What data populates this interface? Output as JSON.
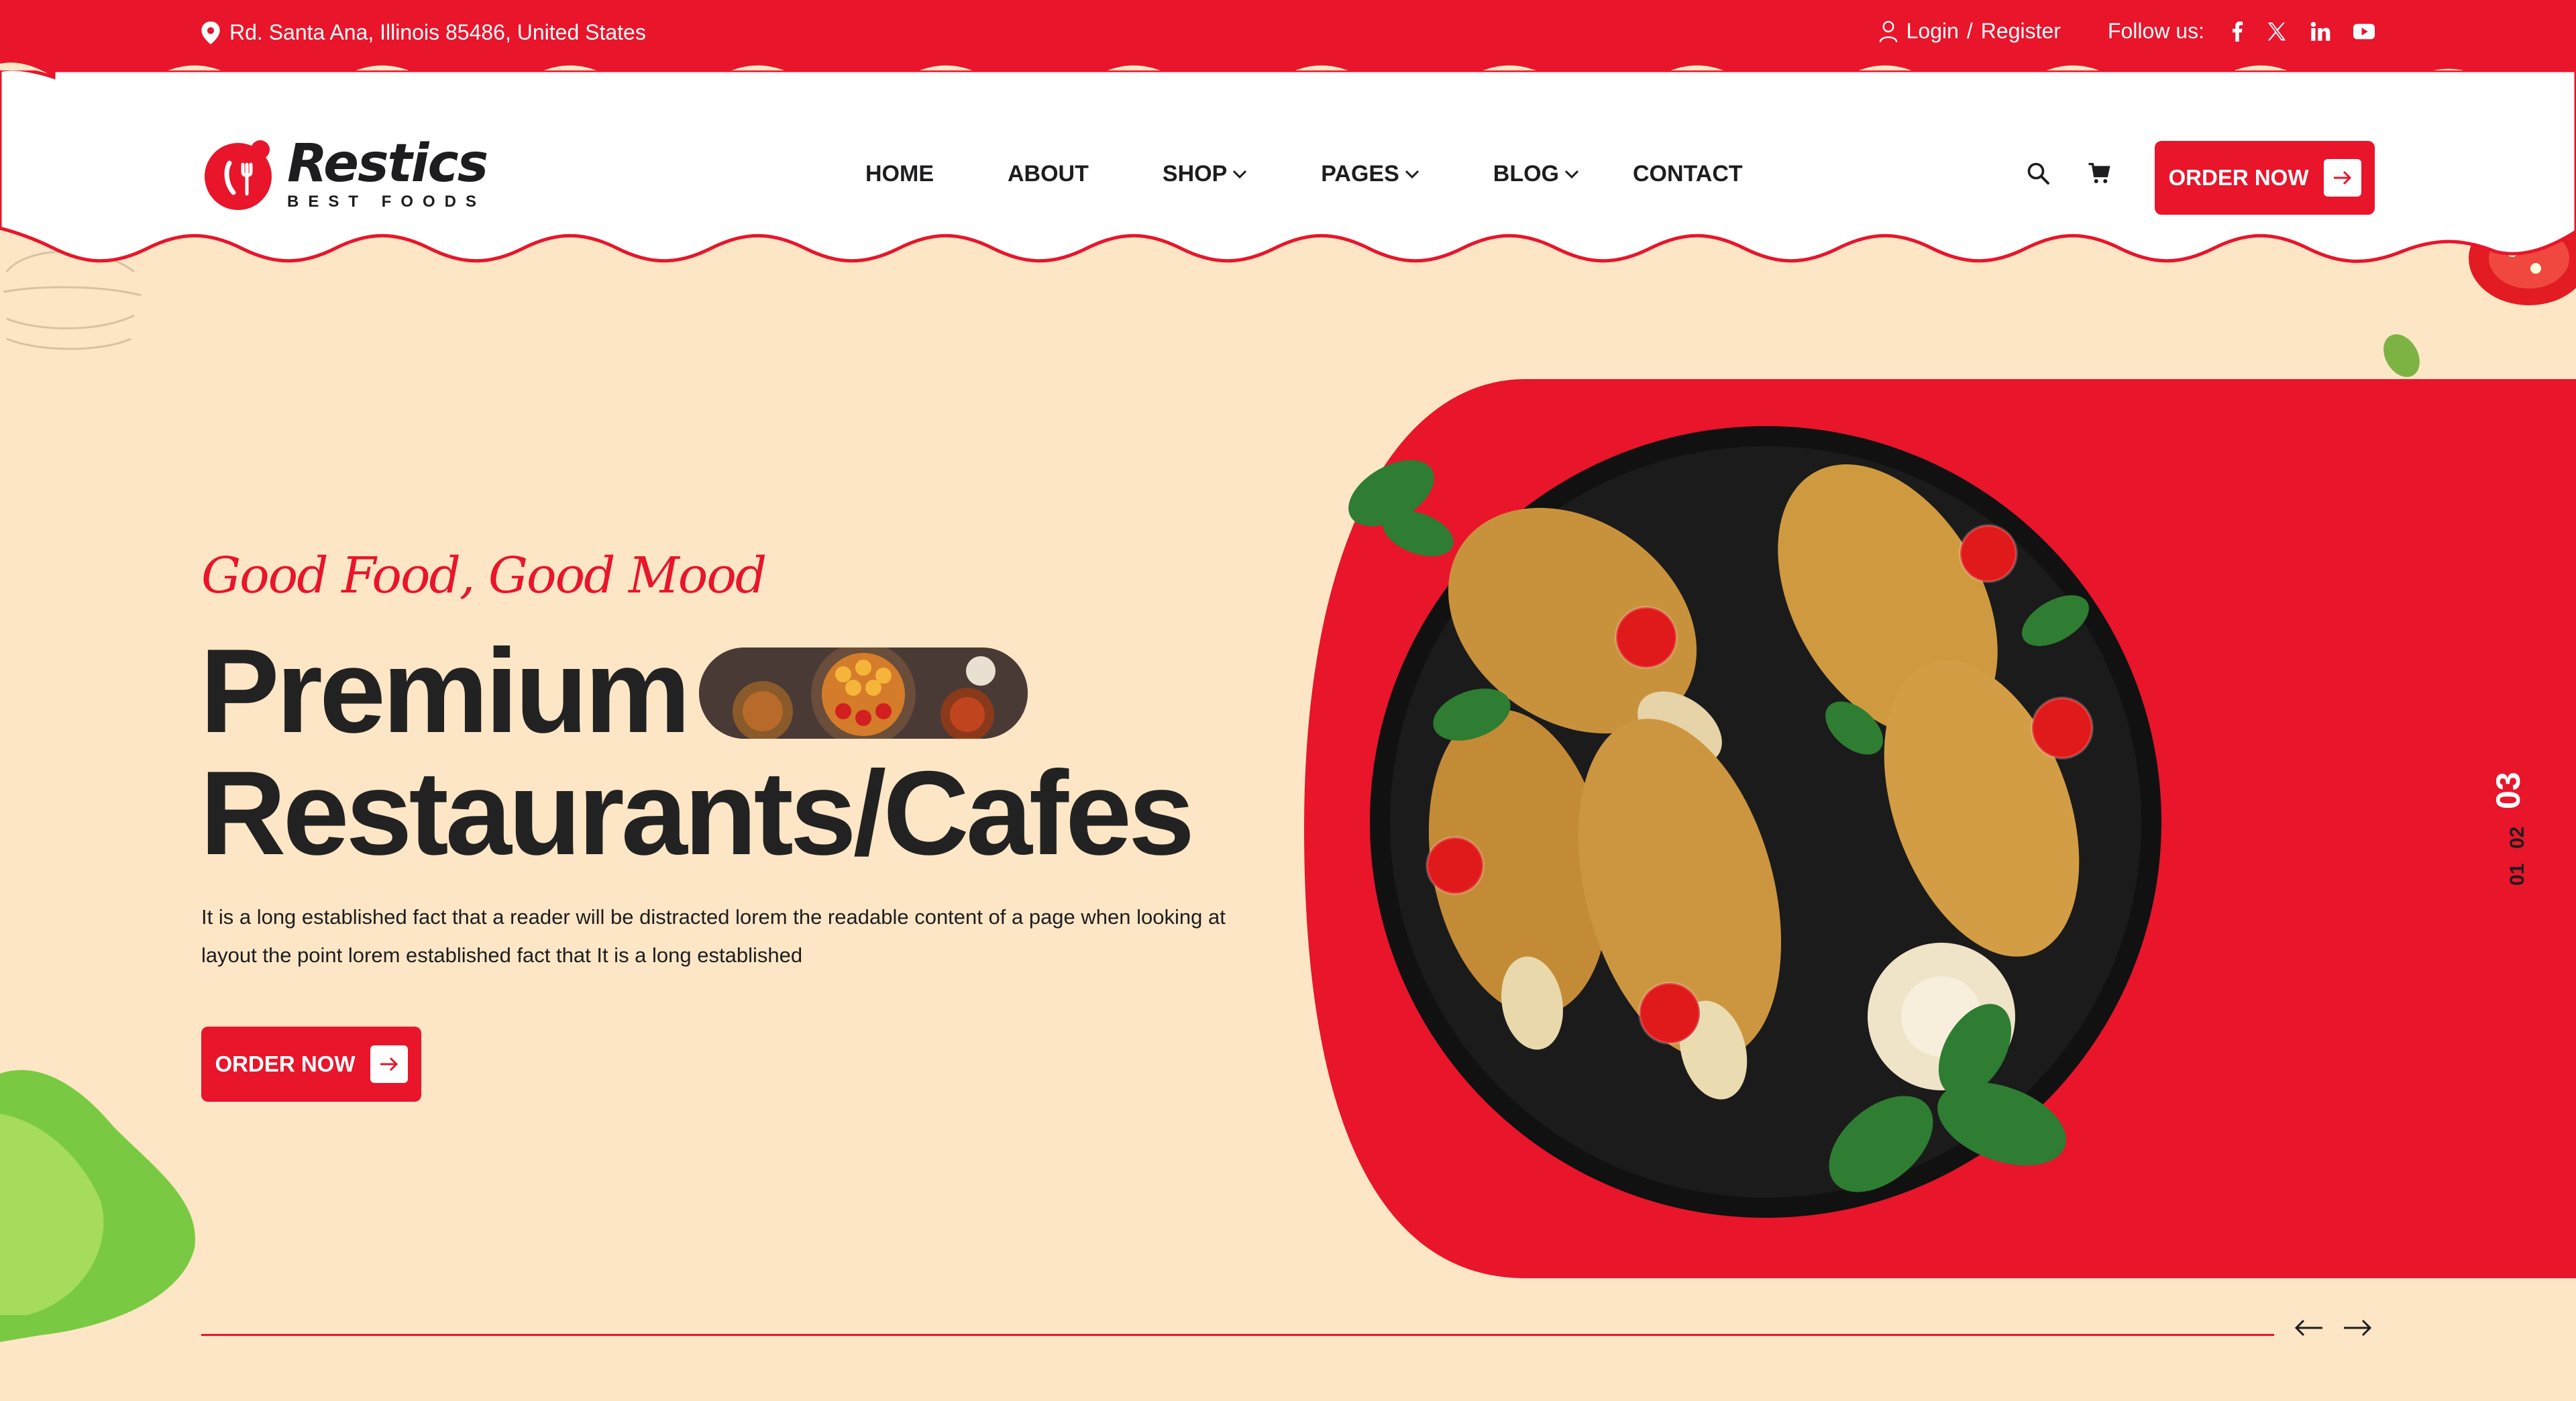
{
  "topbar": {
    "address": "Rd. Santa Ana, Illinois 85486, United States",
    "login": "Login",
    "separator": "/",
    "register": "Register",
    "follow_label": "Follow us:",
    "social_icons": [
      "facebook-icon",
      "x-icon",
      "linkedin-icon",
      "youtube-icon"
    ]
  },
  "brand": {
    "name": "Restics",
    "tagline": "BEST FOODS"
  },
  "nav": {
    "items": [
      {
        "label": "HOME",
        "dropdown": false
      },
      {
        "label": "ABOUT",
        "dropdown": false
      },
      {
        "label": "SHOP",
        "dropdown": true
      },
      {
        "label": "PAGES",
        "dropdown": true
      },
      {
        "label": "BLOG",
        "dropdown": true
      },
      {
        "label": "CONTACT",
        "dropdown": false
      }
    ],
    "order_button": "ORDER NOW"
  },
  "hero": {
    "tagline": "Good Food, Good Mood",
    "headline_line1": "Premium",
    "headline_line2": "Restaurants/Cafes",
    "description": "It is a long established fact that a reader will be distracted lorem the readable content of a page when looking at layout the point lorem established fact that It is a long established",
    "order_button": "ORDER NOW"
  },
  "slider": {
    "slides": [
      "01",
      "02",
      "03"
    ],
    "active": "03"
  },
  "colors": {
    "accent": "#e8152b",
    "background": "#fde6c6",
    "text": "#1d1d1f"
  }
}
